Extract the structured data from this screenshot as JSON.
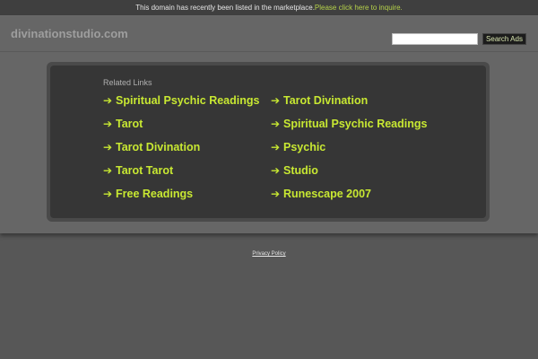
{
  "notice": {
    "text": "This domain has recently been listed in the marketplace.",
    "link": "Please click here to inquire."
  },
  "header": {
    "site_name": "divinationstudio.com",
    "search_placeholder": "",
    "search_button": "Search Ads"
  },
  "related": {
    "heading": "Related Links",
    "arrow": "➔",
    "left_column": [
      "Spiritual Psychic Readings",
      "Tarot",
      "Tarot Divination",
      "Tarot Tarot",
      "Free Readings"
    ],
    "right_column": [
      "Tarot Divination",
      "Spiritual Psychic Readings",
      "Psychic",
      "Studio",
      "Runescape 2007"
    ]
  },
  "footer": {
    "privacy": "Privacy Policy"
  },
  "colors": {
    "background": "#575757",
    "header": "#666666",
    "panel": "#363636",
    "link": "#c8e832",
    "notice_link": "#b6d24a"
  }
}
